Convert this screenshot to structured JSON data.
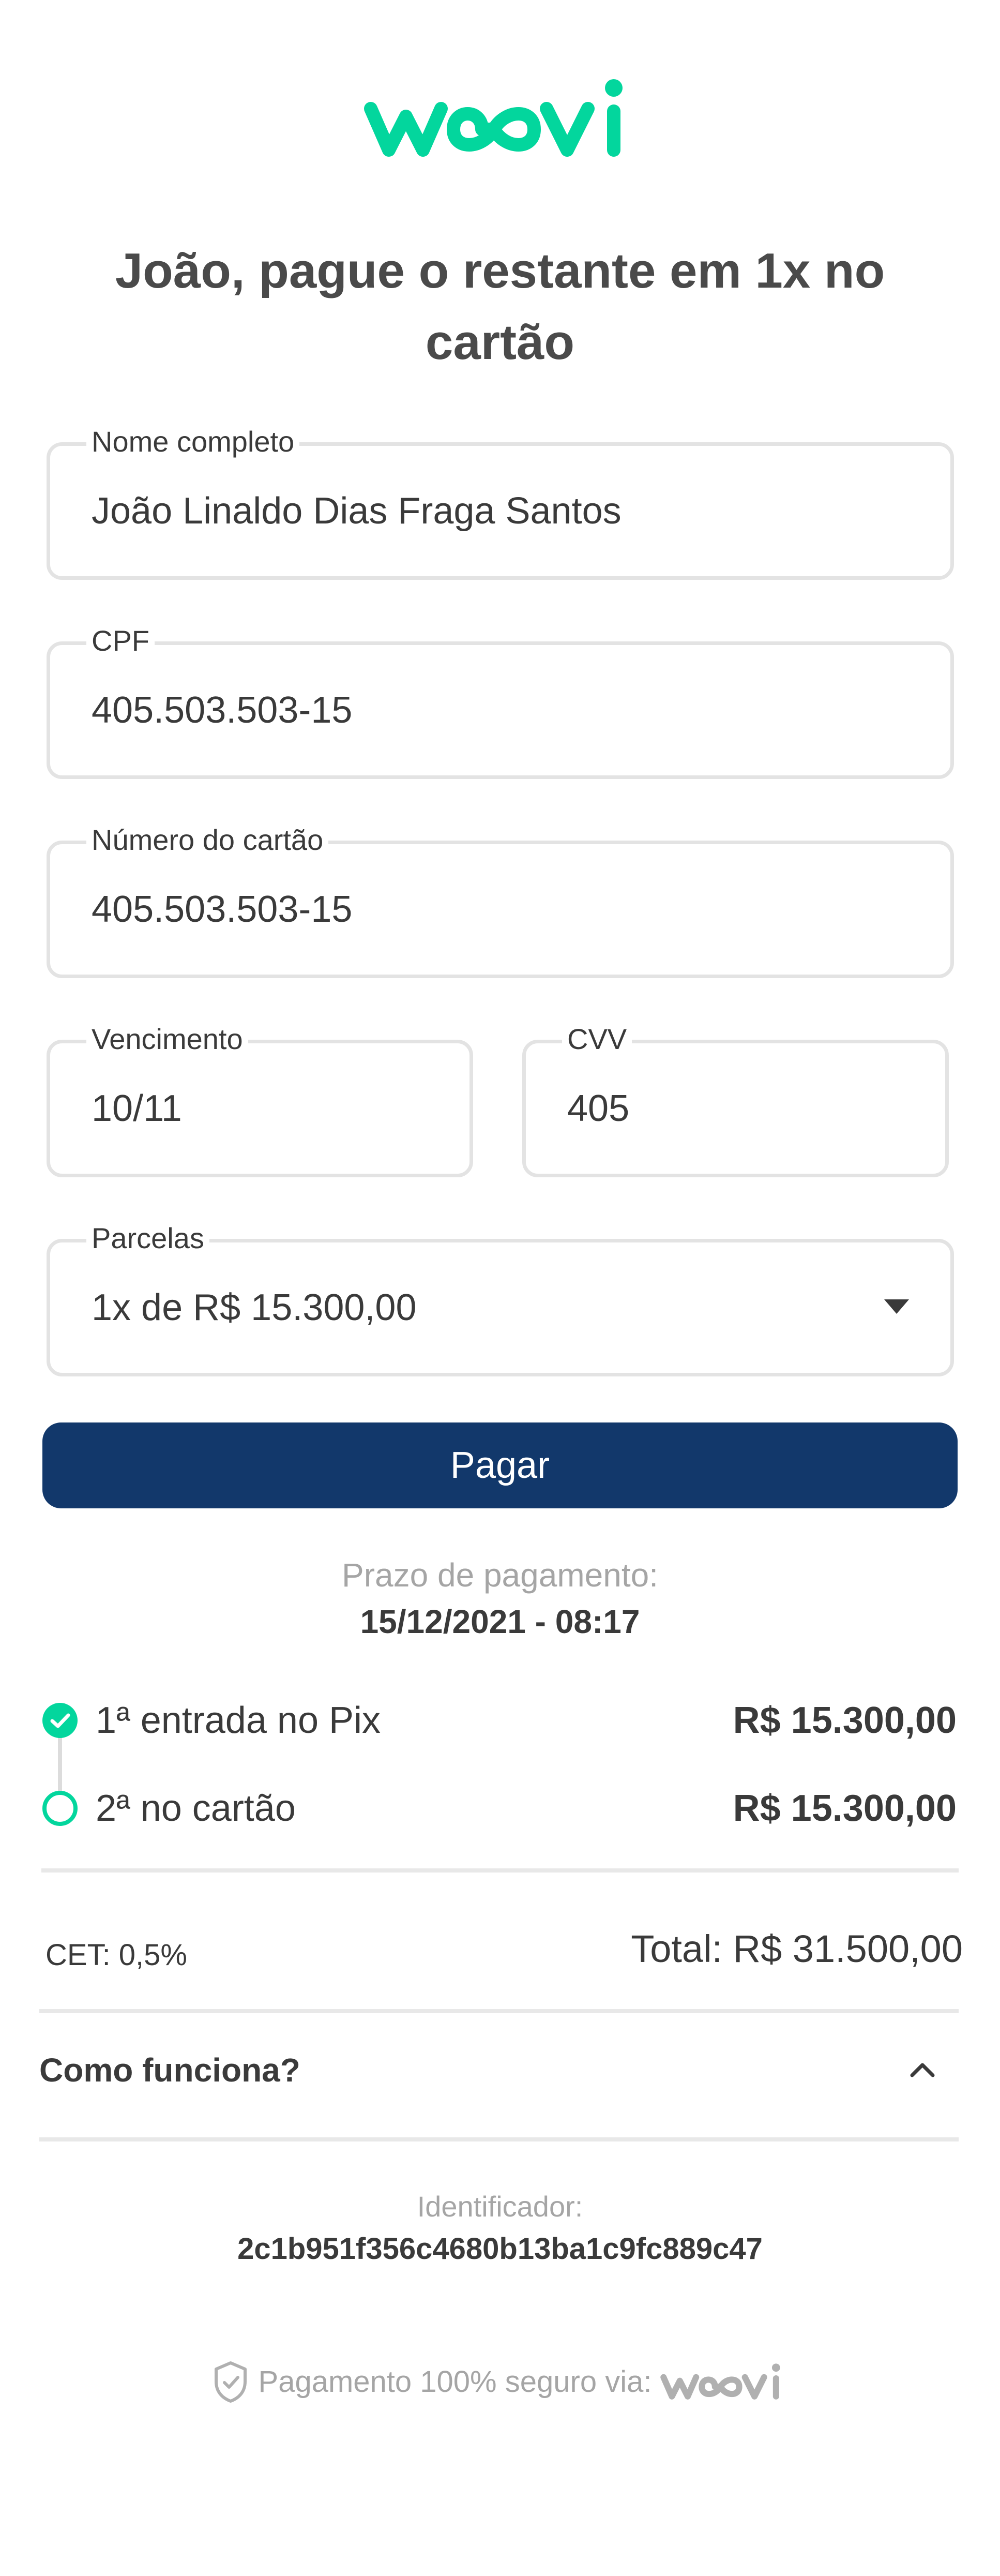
{
  "brand": {
    "name": "woovi",
    "accent": "#03d69d",
    "button_color": "#12386b"
  },
  "title": "João, pague o restante em 1x no cartão",
  "form": {
    "name": {
      "label": "Nome completo",
      "value": "João Linaldo Dias Fraga Santos"
    },
    "cpf": {
      "label": "CPF",
      "value": "405.503.503-15"
    },
    "card_number": {
      "label": "Número do cartão",
      "value": "405.503.503-15"
    },
    "expiry": {
      "label": "Vencimento",
      "value": "10/11"
    },
    "cvv": {
      "label": "CVV",
      "value": "405"
    },
    "installments": {
      "label": "Parcelas",
      "value": "1x de R$ 15.300,00"
    }
  },
  "pay_button": "Pagar",
  "deadline": {
    "label": "Prazo de pagamento:",
    "value": "15/12/2021 - 08:17"
  },
  "steps": [
    {
      "label": "1ª entrada no Pix",
      "amount": "R$ 15.300,00",
      "done": true
    },
    {
      "label": "2ª no cartão",
      "amount": "R$ 15.300,00",
      "done": false
    }
  ],
  "summary": {
    "cet": "CET: 0,5%",
    "total": "Total: R$ 31.500,00"
  },
  "faq": {
    "label": "Como funciona?"
  },
  "identifier": {
    "label": "Identificador:",
    "value": "2c1b951f356c4680b13ba1c9fc889c47"
  },
  "footer": {
    "text": "Pagamento 100% seguro via:",
    "brand": "woovi"
  }
}
